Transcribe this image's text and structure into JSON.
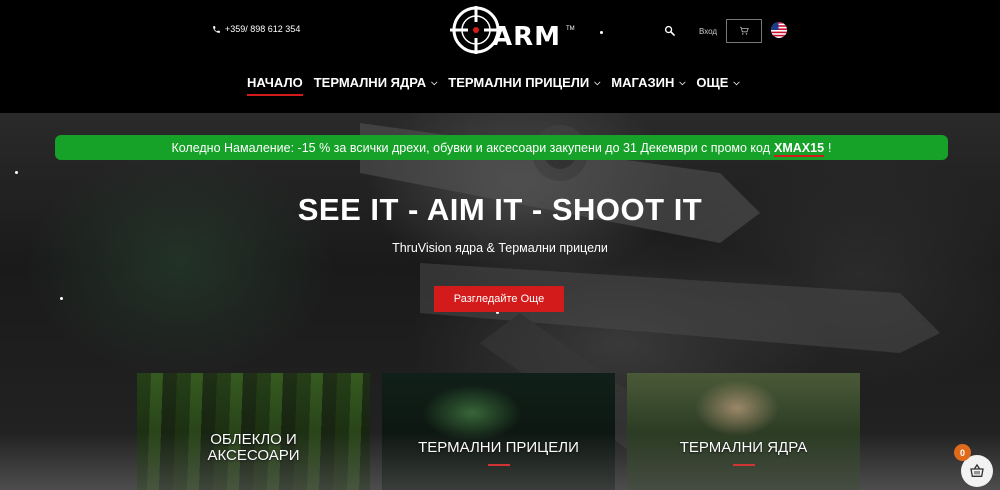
{
  "header": {
    "phone": "+359/ 898 612 354",
    "logo_text": "ARM",
    "logo_tm": "TM",
    "login_label": "Вход",
    "icons": {
      "phone": "phone-icon",
      "search": "search-icon",
      "cart": "cart-icon",
      "language": "us-flag-icon"
    }
  },
  "nav": {
    "items": [
      {
        "label": "НАЧАЛО",
        "active": true,
        "dropdown": false
      },
      {
        "label": "ТЕРМАЛНИ ЯДРА",
        "active": false,
        "dropdown": true
      },
      {
        "label": "ТЕРМАЛНИ ПРИЦЕЛИ",
        "active": false,
        "dropdown": true
      },
      {
        "label": "МАГАЗИН",
        "active": false,
        "dropdown": true
      },
      {
        "label": "ОЩЕ",
        "active": false,
        "dropdown": true
      }
    ]
  },
  "promo": {
    "text": "Коледно Намаление: -15 % за всички дрехи, обувки и аксесоари закупени до 31 Декември с промо код",
    "code": "XMAX15",
    "suffix": "!"
  },
  "hero": {
    "title": "SEE IT - AIM IT - SHOOT IT",
    "subtitle": "ThruVision ядра & Термални прицели",
    "cta": "Разгледайте Още"
  },
  "cards": [
    {
      "line1": "ОБЛЕКЛО И",
      "line2": "АКСЕСОАРИ"
    },
    {
      "line1": "ТЕРМАЛНИ ПРИЦЕЛИ",
      "line2": ""
    },
    {
      "line1": "ТЕРМАЛНИ ЯДРА",
      "line2": ""
    }
  ],
  "floating_cart": {
    "count": "0"
  },
  "colors": {
    "accent_red": "#d41b1b",
    "promo_green": "#16a229",
    "badge_orange": "#e06a1b",
    "header_bg": "#000000"
  }
}
